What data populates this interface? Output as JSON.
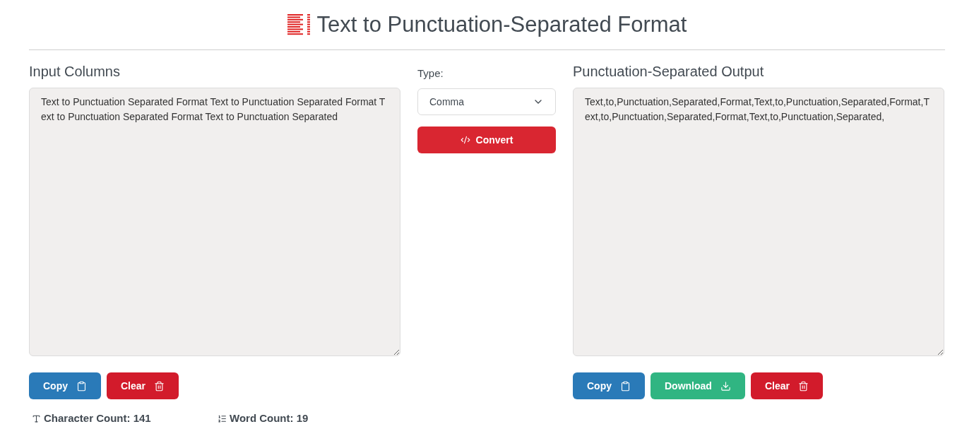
{
  "title": "Text to Punctuation-Separated Format",
  "input": {
    "heading": "Input Columns",
    "value": "Text to Punctuation Separated Format Text to Punctuation Separated Format Text to Punctuation Separated Format Text to Punctuation Separated",
    "buttons": [
      {
        "kind": "copy",
        "label": "Copy"
      },
      {
        "kind": "clear",
        "label": "Clear"
      }
    ]
  },
  "stats": [
    {
      "kind": "characters",
      "label": "Character Count: 141"
    },
    {
      "kind": "words",
      "label": "Word Count: 19"
    }
  ],
  "type": {
    "label": "Type:",
    "value": "Comma"
  },
  "convert": {
    "label": "Convert"
  },
  "output": {
    "heading": "Punctuation-Separated Output",
    "value": "Text,to,Punctuation,Separated,Format,Text,to,Punctuation,Separated,Format,Text,to,Punctuation,Separated,Format,Text,to,Punctuation,Separated,",
    "buttons": [
      {
        "kind": "copy",
        "label": "Copy"
      },
      {
        "kind": "download",
        "label": "Download"
      },
      {
        "kind": "clear",
        "label": "Clear"
      }
    ]
  }
}
